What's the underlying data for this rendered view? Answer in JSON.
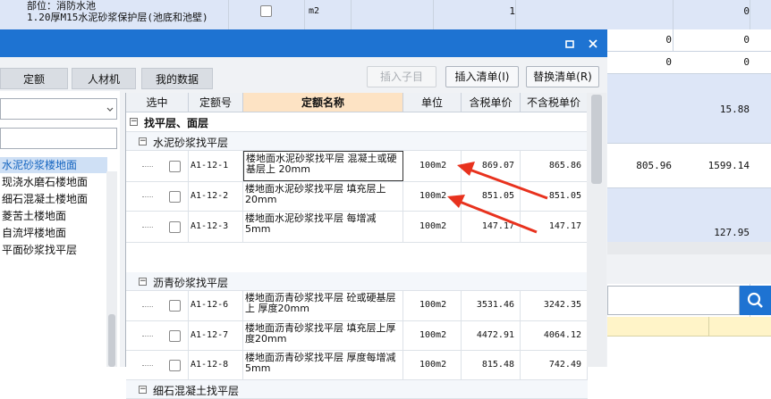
{
  "background": {
    "top_row": {
      "location": "部位：消防水池",
      "item": "1.20厚M15水泥砂浆保护层(池底和池壁)",
      "unit": "m2",
      "qty": "1",
      "val": "0"
    },
    "rows": [
      {
        "c1": "0",
        "c2": "0",
        "c3": "0"
      },
      {
        "c1": "0",
        "c2": "0",
        "c3": "0"
      }
    ],
    "v1": "15.88",
    "a": "805.96",
    "b": "1599.14",
    "v3": "127.95"
  },
  "dialog": {
    "tabs": [
      "定额",
      "人材机",
      "我的数据"
    ],
    "buttons": {
      "insert_child": "插入子目",
      "insert_list": "插入清单(I)",
      "replace_list": "替换清单(R)"
    },
    "left_list": [
      "水泥砂浆楼地面",
      "现浇水磨石楼地面",
      "细石混凝土楼地面",
      "菱苦土楼地面",
      "自流坪楼地面",
      "平面砂浆找平层"
    ],
    "columns": [
      "选中",
      "定额号",
      "定额名称",
      "单位",
      "含税单价",
      "不含税单价"
    ],
    "top_group": "找平层、面层",
    "groups": [
      {
        "name": "水泥砂浆找平层",
        "rows": [
          {
            "code": "A1-12-1",
            "name": "楼地面水泥砂浆找平层 混凝土或硬基层上 20mm",
            "unit": "100m2",
            "tax": "869.07",
            "notax": "865.86"
          },
          {
            "code": "A1-12-2",
            "name": "楼地面水泥砂浆找平层 填充层上20mm",
            "unit": "100m2",
            "tax": "851.05",
            "notax": "851.05"
          },
          {
            "code": "A1-12-3",
            "name": "楼地面水泥砂浆找平层 每增减5mm",
            "unit": "100m2",
            "tax": "147.17",
            "notax": "147.17"
          }
        ]
      },
      {
        "name": "沥青砂浆找平层",
        "rows": [
          {
            "code": "A1-12-6",
            "name": "楼地面沥青砂浆找平层 砼或硬基层上 厚度20mm",
            "unit": "100m2",
            "tax": "3531.46",
            "notax": "3242.35"
          },
          {
            "code": "A1-12-7",
            "name": "楼地面沥青砂浆找平层 填充层上厚度20mm",
            "unit": "100m2",
            "tax": "4472.91",
            "notax": "4064.12"
          },
          {
            "code": "A1-12-8",
            "name": "楼地面沥青砂浆找平层 厚度每增减5mm",
            "unit": "100m2",
            "tax": "815.48",
            "notax": "742.49"
          }
        ]
      },
      {
        "name": "细石混凝土找平层",
        "rows": []
      }
    ]
  },
  "colors": {
    "title_bar": "#1e73d2",
    "header_highlight": "#fde3c4",
    "selected_item": "#1565c0",
    "arrow": "#e8321e"
  }
}
